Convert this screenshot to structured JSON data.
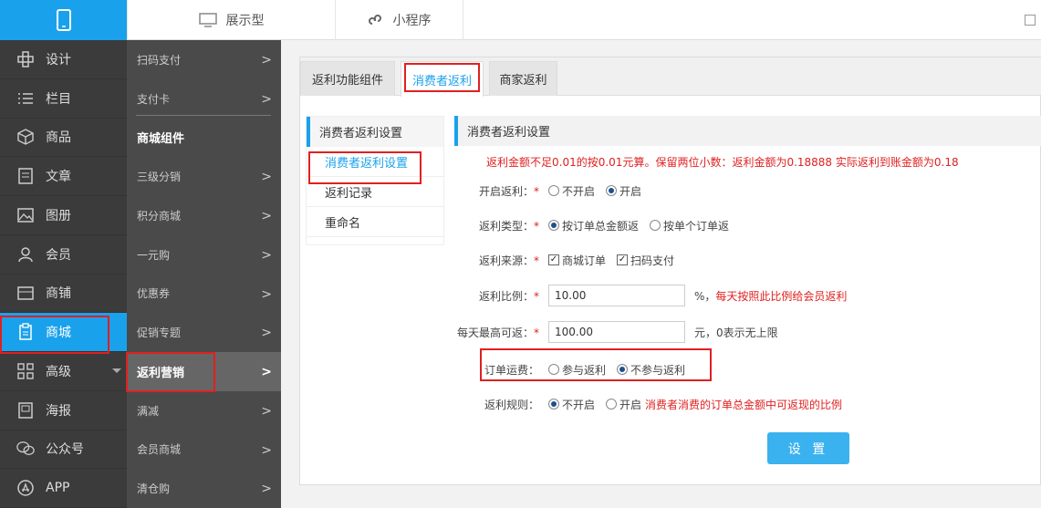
{
  "topbar": {
    "tabs": [
      {
        "label": "展示型",
        "icon": "monitor-icon"
      },
      {
        "label": "小程序",
        "icon": "mini-program-icon"
      }
    ]
  },
  "sidebar": {
    "items": [
      {
        "label": "设计",
        "icon": "design-icon"
      },
      {
        "label": "栏目",
        "icon": "list-icon"
      },
      {
        "label": "商品",
        "icon": "box-icon"
      },
      {
        "label": "文章",
        "icon": "article-icon"
      },
      {
        "label": "图册",
        "icon": "image-icon"
      },
      {
        "label": "会员",
        "icon": "user-icon"
      },
      {
        "label": "商铺",
        "icon": "shop-icon"
      },
      {
        "label": "商城",
        "icon": "clipboard-icon",
        "active": true
      },
      {
        "label": "高级",
        "icon": "grid-icon"
      },
      {
        "label": "海报",
        "icon": "poster-icon"
      },
      {
        "label": "公众号",
        "icon": "wechat-icon"
      },
      {
        "label": "APP",
        "icon": "app-store-icon"
      }
    ]
  },
  "subbar": {
    "items": [
      "扫码支付",
      "支付卡",
      "商城组件",
      "三级分销",
      "积分商城",
      "一元购",
      "优惠券",
      "促销专题",
      "返利营销",
      "满减",
      "会员商城",
      "清仓购"
    ]
  },
  "tabs": [
    "返利功能组件",
    "消费者返利",
    "商家返利"
  ],
  "leftmenu": {
    "header": "消费者返利设置",
    "items": [
      "消费者返利设置",
      "返利记录",
      "重命名"
    ]
  },
  "content": {
    "header": "消费者返利设置",
    "note": "返利金额不足0.01的按0.01元算。保留两位小数：返利金额为0.18888 实际返利到账金额为0.18",
    "enable": {
      "label": "开启返利：",
      "opt1": "不开启",
      "opt2": "开启"
    },
    "type": {
      "label": "返利类型：",
      "opt1": "按订单总金额返",
      "opt2": "按单个订单返"
    },
    "source": {
      "label": "返利来源：",
      "opt1": "商城订单",
      "opt2": "扫码支付"
    },
    "ratio": {
      "label": "返利比例：",
      "value": "10.00",
      "unit": "%，",
      "hint": "每天按照此比例给会员返利"
    },
    "maxday": {
      "label": "每天最高可返：",
      "value": "100.00",
      "hint": "元，0表示无上限"
    },
    "shipping": {
      "label": "订单运费：",
      "opt1": "参与返利",
      "opt2": "不参与返利"
    },
    "rule": {
      "label": "返利规则：",
      "opt1": "不开启",
      "opt2": "开启",
      "hint": "消费者消费的订单总金额中可返现的比例"
    },
    "submit": "设 置",
    "required_mark": "*"
  },
  "colors": {
    "accent": "#1aa1ec",
    "highlight": "#e02020"
  }
}
